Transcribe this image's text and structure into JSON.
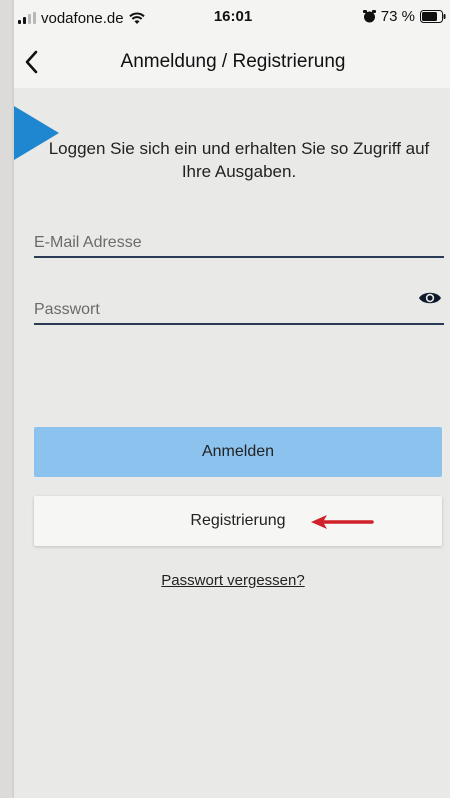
{
  "status_bar": {
    "carrier": "vodafone.de",
    "time": "16:01",
    "battery": "73 %"
  },
  "nav": {
    "title": "Anmeldung / Registrierung",
    "back_icon": "chevron-left-icon"
  },
  "intro_text": "Loggen Sie sich ein und erhalten Sie so Zugriff auf Ihre Ausgaben.",
  "form": {
    "email_placeholder": "E-Mail Adresse",
    "email_value": "",
    "password_placeholder": "Passwort",
    "password_value": "",
    "password_toggle_icon": "eye-icon"
  },
  "buttons": {
    "login_label": "Anmelden",
    "register_label": "Registrierung",
    "forgot_label": "Passwort vergessen?"
  },
  "colors": {
    "login_button": "#8cc3ee",
    "register_button": "#f6f6f4",
    "field_underline": "#2a3b55",
    "annotation_arrow": "#d0202a",
    "corner_marker": "#1e87cf"
  }
}
